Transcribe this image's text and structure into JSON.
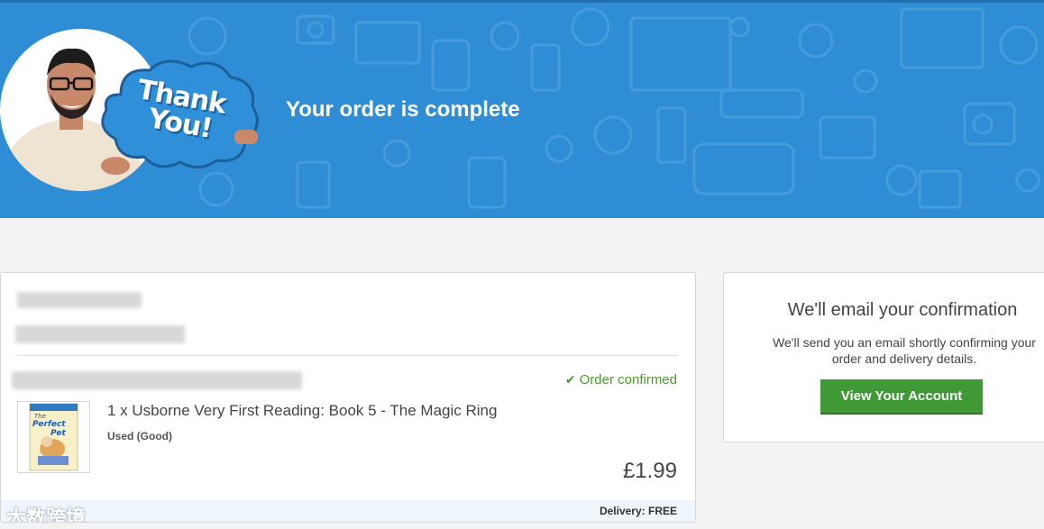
{
  "banner": {
    "title": "Your order is complete",
    "badge_line1": "Thank",
    "badge_line2": "You!"
  },
  "order": {
    "status": "Order confirmed",
    "item_title": "1 x Usborne Very First Reading: Book 5 - The Magic Ring",
    "item_condition": "Used (Good)",
    "price": "£1.99",
    "delivery": "Delivery: FREE",
    "book_cover_title_1": "The",
    "book_cover_title_2": "Perfect",
    "book_cover_title_3": "Pet"
  },
  "email_card": {
    "title": "We'll email your confirmation",
    "text": "We'll send you an email shortly confirming your order and delivery details.",
    "button": "View Your Account"
  },
  "watermark": "大数跨境",
  "colors": {
    "banner": "#2e8dd4",
    "button": "#3f9a36",
    "confirmed": "#4c9a2a"
  }
}
